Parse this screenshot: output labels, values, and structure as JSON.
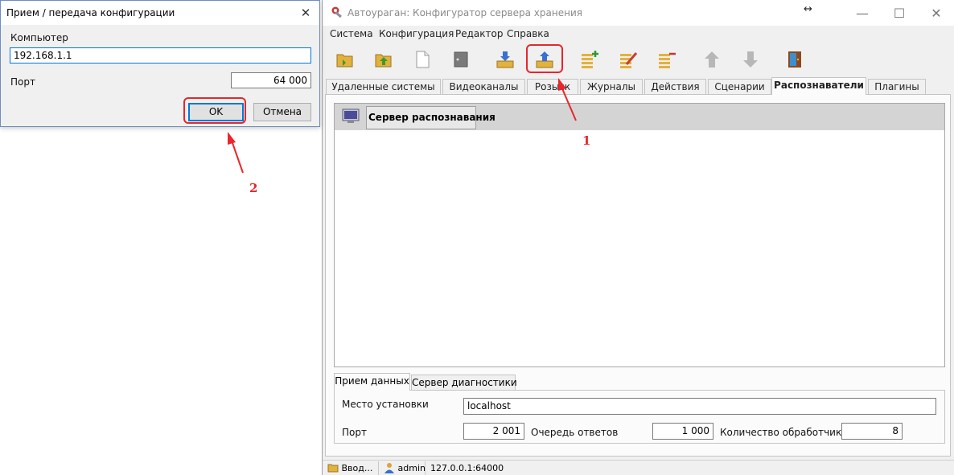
{
  "main_window": {
    "title": "Автоураган: Конфигуратор сервера хранения",
    "controls": {
      "minimize": "—",
      "maximize": "☐",
      "close": "✕"
    },
    "menu": [
      "Система",
      "Конфигурация",
      "Редактор",
      "Справка"
    ],
    "toolbar_icons": [
      "open-folder-icon",
      "folder-up-icon",
      "new-document-icon",
      "delete-document-icon",
      "receive-config-icon",
      "send-config-icon",
      "add-list-icon",
      "edit-list-icon",
      "remove-list-icon",
      "move-up-icon",
      "move-down-icon",
      "exit-door-icon"
    ],
    "tabs": [
      "Удаленные системы",
      "Видеоканалы",
      "Розыск",
      "Журналы",
      "Действия",
      "Сценарии",
      "Распознаватели",
      "Плагины"
    ],
    "active_tab": "Распознаватели",
    "list_header_label": "Сервер распознавания",
    "bottom_tabs": [
      "Прием данных",
      "Сервер диагностики"
    ],
    "fields": {
      "location_label": "Место установки",
      "location_value": "localhost",
      "port_label": "Порт",
      "port_value": "2 001",
      "queue_label": "Очередь ответов",
      "queue_value": "1 000",
      "handlers_label": "Количество обработчиков",
      "handlers_value": "8"
    },
    "status": {
      "mode": "Ввод...",
      "user": "admin",
      "address": "127.0.0.1:64000"
    }
  },
  "dialog": {
    "title": "Прием / передача конфигурации",
    "close": "✕",
    "computer_label": "Компьютер",
    "computer_value": "192.168.1.1",
    "port_label": "Порт",
    "port_value": "64 000",
    "ok_label": "OK",
    "cancel_label": "Отмена"
  },
  "annotations": {
    "marker_1": "1",
    "marker_2": "2",
    "color": "#e8262b"
  }
}
